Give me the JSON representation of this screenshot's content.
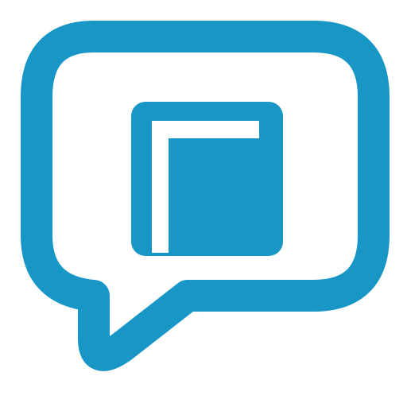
{
  "logo": {
    "name": "chat-book-logo",
    "icon": "chat-bubble-with-book-icon",
    "colors": {
      "primary": "#1897c6",
      "background": "#ffffff"
    }
  }
}
